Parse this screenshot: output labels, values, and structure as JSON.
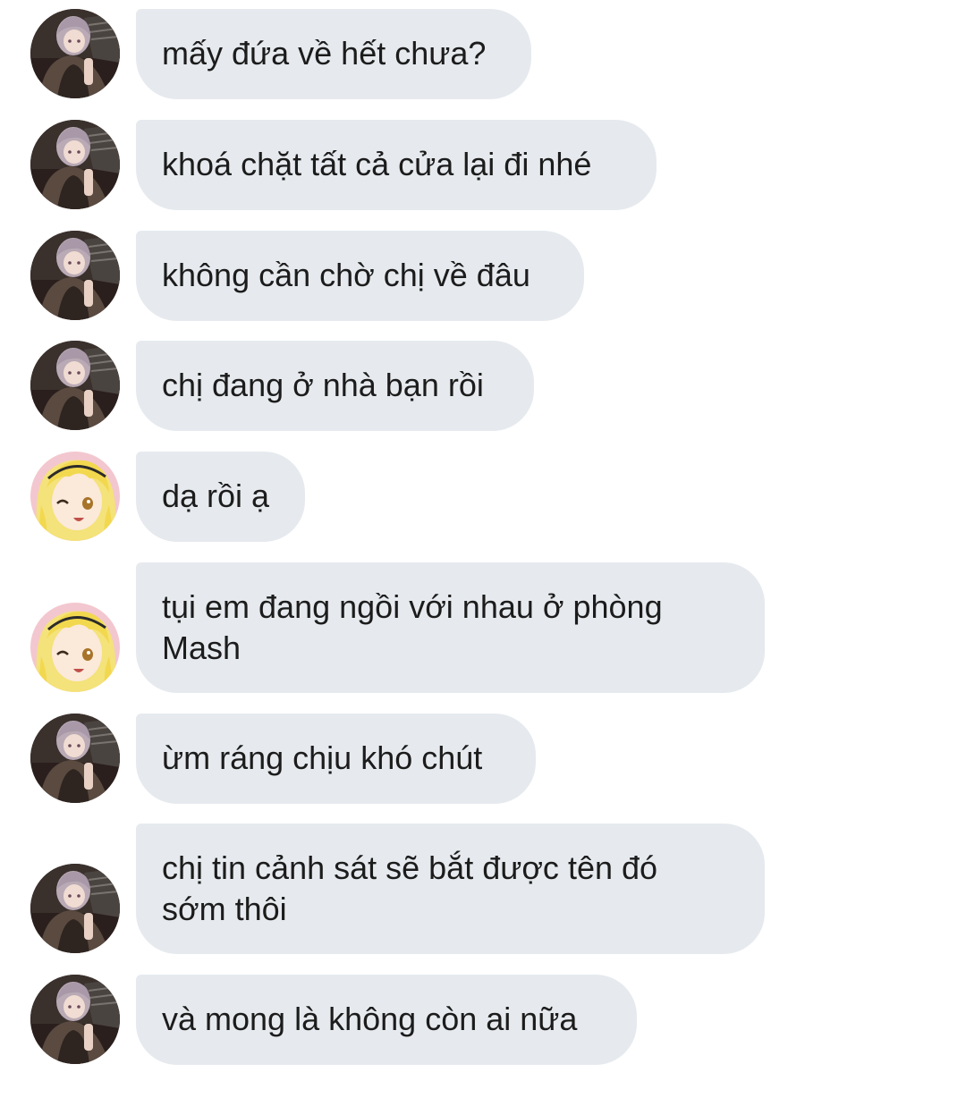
{
  "conversation": {
    "messages": [
      {
        "sender": "gray-haired",
        "text": "mấy đứa về hết chưa?"
      },
      {
        "sender": "gray-haired",
        "text": "khoá chặt tất cả cửa lại đi nhé"
      },
      {
        "sender": "gray-haired",
        "text": "không cần chờ chị về đâu"
      },
      {
        "sender": "gray-haired",
        "text": "chị đang ở nhà bạn rồi"
      },
      {
        "sender": "blonde",
        "text": "dạ rồi ạ"
      },
      {
        "sender": "blonde",
        "text": "tụi em đang ngồi với nhau ở phòng\nMash"
      },
      {
        "sender": "gray-haired",
        "text": "ừm ráng chịu khó chút"
      },
      {
        "sender": "gray-haired",
        "text": "chị tin cảnh sát sẽ bắt được tên đó\nsớm thôi"
      },
      {
        "sender": "gray-haired",
        "text": "và mong là không còn ai nữa"
      }
    ]
  },
  "colors": {
    "bubble": "#e6eaee",
    "text": "#1c1c1c",
    "background": "#ffffff"
  }
}
